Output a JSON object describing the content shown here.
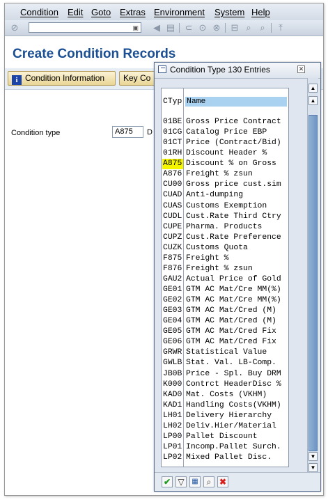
{
  "menubar": {
    "items": [
      "Condition",
      "Edit",
      "Goto",
      "Extras",
      "Environment",
      "System",
      "Help"
    ]
  },
  "toolbar": {
    "command_value": ""
  },
  "page": {
    "title": "Create Condition Records"
  },
  "app_toolbar": {
    "condition_info_label": "Condition Information",
    "key_combination_label": "Key Co"
  },
  "form": {
    "condition_type_label": "Condition type",
    "condition_type_value": "A875",
    "after_field_text": "D"
  },
  "popup": {
    "title": "Condition Type 130 Entries",
    "column_ctyp": "CTyp",
    "column_name": "Name",
    "highlight_index": 4,
    "rows": [
      {
        "code": "01BE",
        "name": "Gross Price Contract"
      },
      {
        "code": "01CG",
        "name": "Catalog Price EBP"
      },
      {
        "code": "01CT",
        "name": "Price (Contract/Bid)"
      },
      {
        "code": "01RH",
        "name": "Discount Header %"
      },
      {
        "code": "A875",
        "name": "Discount % on Gross"
      },
      {
        "code": "A876",
        "name": "Freight % zsun"
      },
      {
        "code": "CU00",
        "name": "Gross price cust.sim"
      },
      {
        "code": "CUAD",
        "name": "Anti-dumping"
      },
      {
        "code": "CUAS",
        "name": "Customs Exemption"
      },
      {
        "code": "CUDL",
        "name": "Cust.Rate Third Ctry"
      },
      {
        "code": "CUPE",
        "name": "Pharma. Products"
      },
      {
        "code": "CUPZ",
        "name": "Cust.Rate Preference"
      },
      {
        "code": "CUZK",
        "name": "Customs Quota"
      },
      {
        "code": "F875",
        "name": "Freight %"
      },
      {
        "code": "F876",
        "name": "Freight % zsun"
      },
      {
        "code": "GAU2",
        "name": "Actual Price of Gold"
      },
      {
        "code": "GE01",
        "name": "GTM AC Mat/Cre MM(%)"
      },
      {
        "code": "GE02",
        "name": "GTM AC Mat/Cre MM(%)"
      },
      {
        "code": "GE03",
        "name": "GTM AC Mat/Cred (M)"
      },
      {
        "code": "GE04",
        "name": "GTM AC Mat/Cred (M)"
      },
      {
        "code": "GE05",
        "name": "GTM AC Mat/Cred Fix"
      },
      {
        "code": "GE06",
        "name": "GTM AC Mat/Cred Fix"
      },
      {
        "code": "GRWR",
        "name": "Statistical Value"
      },
      {
        "code": "GWLB",
        "name": "Stat. Val. LB-Comp."
      },
      {
        "code": "JB0B",
        "name": "Price - Spl. Buy DRM"
      },
      {
        "code": "K000",
        "name": "Contrct HeaderDisc %"
      },
      {
        "code": "KAD0",
        "name": "Mat. Costs  (VKHM)"
      },
      {
        "code": "KAD1",
        "name": "Handling Costs(VKHM)"
      },
      {
        "code": "LH01",
        "name": "Delivery Hierarchy"
      },
      {
        "code": "LH02",
        "name": "Deliv.Hier/Material"
      },
      {
        "code": "LP00",
        "name": "Pallet Discount"
      },
      {
        "code": "LP01",
        "name": "Incomp.Pallet Surch."
      },
      {
        "code": "LP02",
        "name": "Mixed Pallet Disc."
      }
    ]
  },
  "colors": {
    "title_blue": "#1b4f93",
    "header_highlight": "#a9d2f0",
    "row_highlight": "#f5f500",
    "button_gold": "#e9d595"
  }
}
